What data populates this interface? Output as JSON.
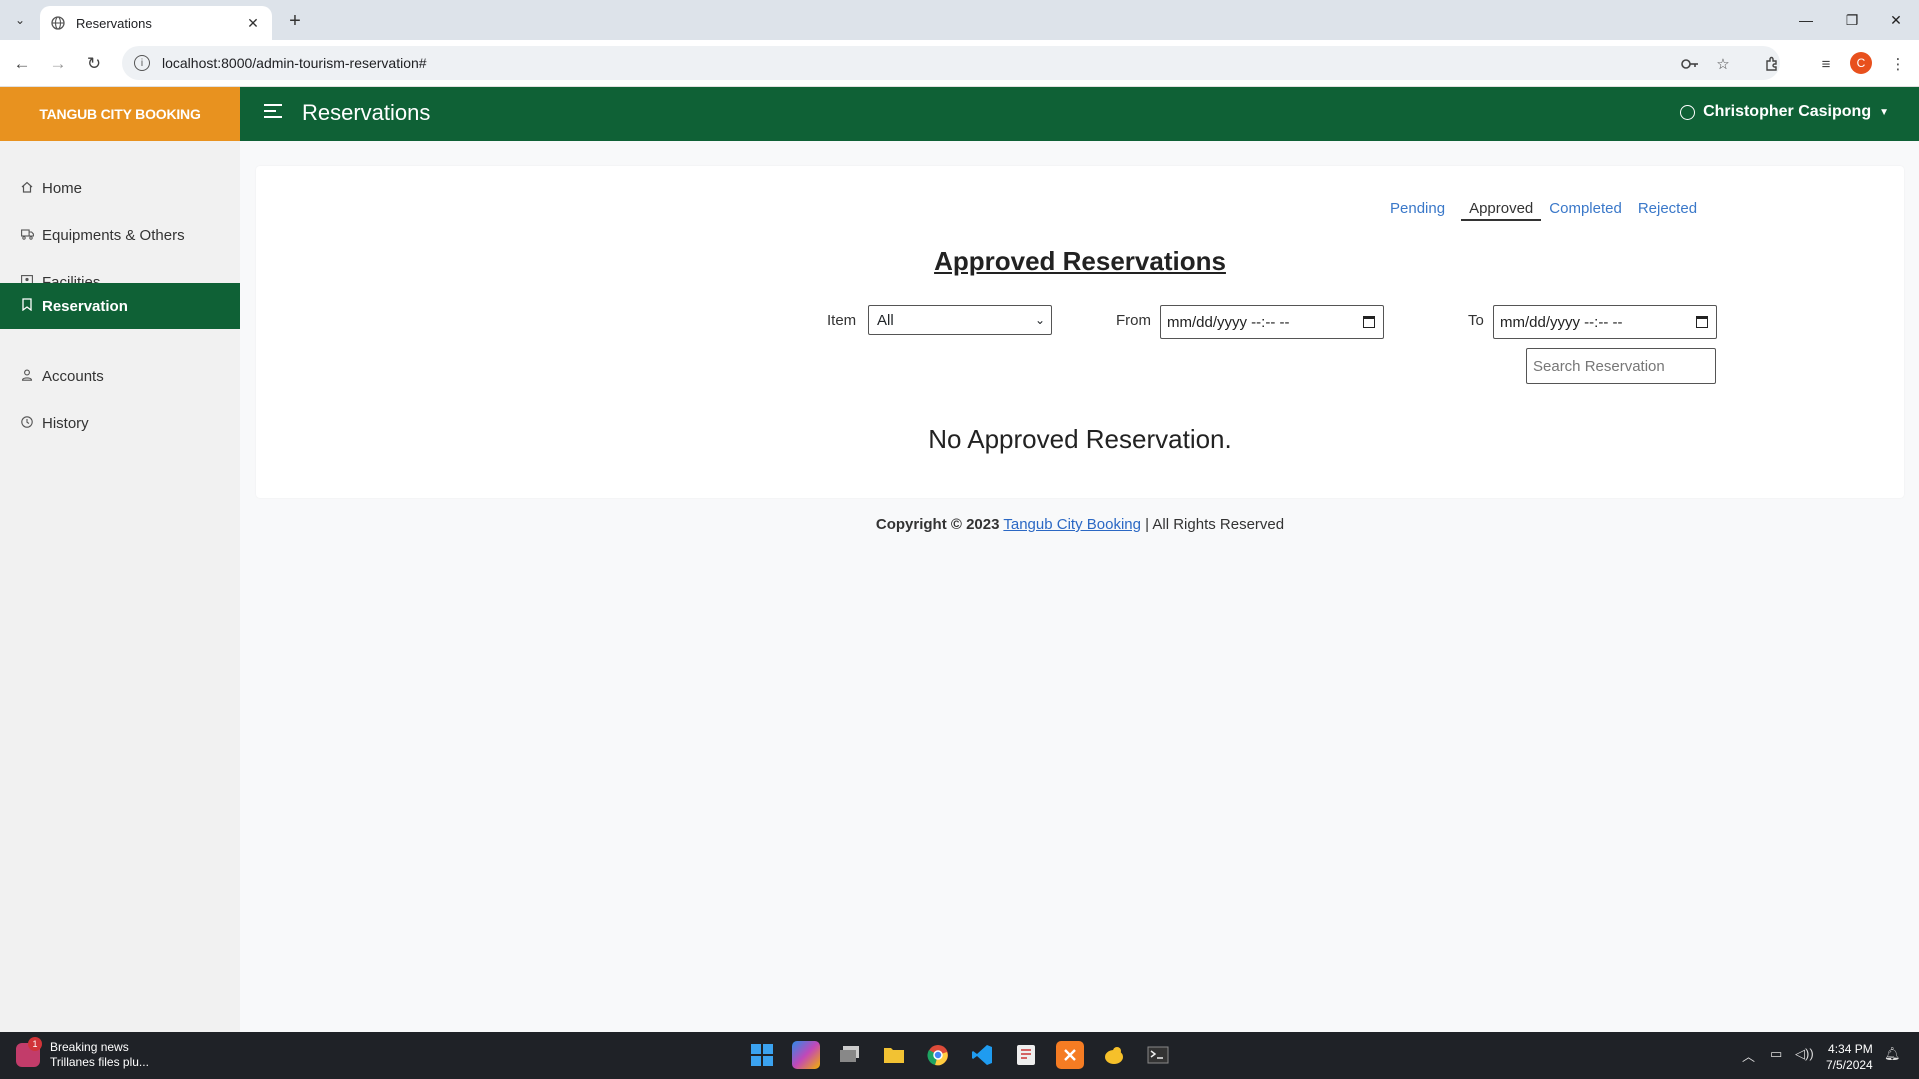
{
  "browser": {
    "tab_title": "Reservations",
    "new_tab_symbol": "+",
    "url": "localhost:8000/admin-tourism-reservation#",
    "profile_initial": "C"
  },
  "app": {
    "brand": "TANGUB CITY BOOKING",
    "page_title": "Reservations",
    "user_name": "Christopher Casipong"
  },
  "sidebar": {
    "items": [
      {
        "label": "Home",
        "icon": "home-icon"
      },
      {
        "label": "Equipments & Others",
        "icon": "truck-icon"
      },
      {
        "label": "Facilities",
        "icon": "image-icon"
      },
      {
        "label": "Reservation",
        "icon": "bookmark-icon",
        "active": true
      },
      {
        "label": "Accounts",
        "icon": "person-icon"
      },
      {
        "label": "History",
        "icon": "clock-icon"
      }
    ]
  },
  "status_tabs": [
    {
      "label": "Pending"
    },
    {
      "label": "Approved",
      "current": true
    },
    {
      "label": "Completed"
    },
    {
      "label": "Rejected"
    }
  ],
  "main": {
    "heading": "Approved Reservations",
    "item_label": "Item",
    "item_value": "All",
    "from_label": "From",
    "from_value": "mm/dd/yyyy --:-- --",
    "to_label": "To",
    "to_value": "mm/dd/yyyy --:-- --",
    "search_placeholder": "Search Reservation",
    "empty_message": "No Approved Reservation."
  },
  "footer": {
    "copyright": "Copyright © 2023",
    "link": "Tangub City Booking",
    "rights": "| All Rights Reserved"
  },
  "taskbar": {
    "news_title": "Breaking news",
    "news_subtitle": "Trillanes files plu...",
    "news_badge": "1",
    "time": "4:34 PM",
    "date": "7/5/2024"
  },
  "colors": {
    "brand_orange": "#e8921f",
    "primary_green": "#0f6136",
    "link_blue": "#3a78c9"
  }
}
